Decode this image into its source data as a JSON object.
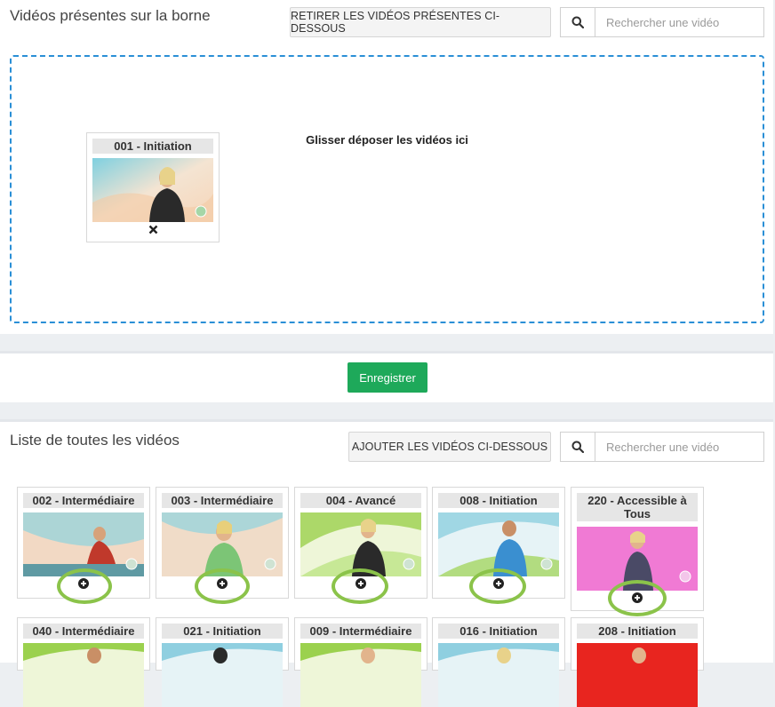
{
  "top_panel": {
    "title": "Vidéos présentes sur la borne",
    "remove_button": "RETIRER LES VIDÉOS PRÉSENTES CI-DESSOUS",
    "search_placeholder": "Rechercher une vidéo",
    "drop_hint": "Glisser déposer les vidéos ici",
    "videos": [
      {
        "title": "001 - Initiation",
        "action_icon": "remove-icon"
      }
    ]
  },
  "save_panel": {
    "save_button": "Enregistrer"
  },
  "list_panel": {
    "title": "Liste de toutes les vidéos",
    "add_button": "AJOUTER LES VIDÉOS CI-DESSOUS",
    "search_placeholder": "Rechercher une vidéo",
    "videos": [
      {
        "title": "002 - Intermédiaire",
        "action_icon": "add-circle-icon"
      },
      {
        "title": "003 - Intermédiaire",
        "action_icon": "add-circle-icon"
      },
      {
        "title": "004 - Avancé",
        "action_icon": "add-circle-icon"
      },
      {
        "title": "008 - Initiation",
        "action_icon": "add-circle-icon"
      },
      {
        "title": "220 - Accessible à Tous",
        "action_icon": "add-circle-icon"
      },
      {
        "title": "040 - Intermédiaire",
        "action_icon": "add-circle-icon"
      },
      {
        "title": "021 - Initiation",
        "action_icon": "add-circle-icon"
      },
      {
        "title": "009 - Intermédiaire",
        "action_icon": "add-circle-icon"
      },
      {
        "title": "016 - Initiation",
        "action_icon": "add-circle-icon"
      },
      {
        "title": "208 - Initiation",
        "action_icon": "add-circle-icon"
      }
    ]
  },
  "colors": {
    "accent_blue": "#2a8fd6",
    "save_green": "#1ea95a",
    "highlight_circle": "#8bc34a"
  }
}
